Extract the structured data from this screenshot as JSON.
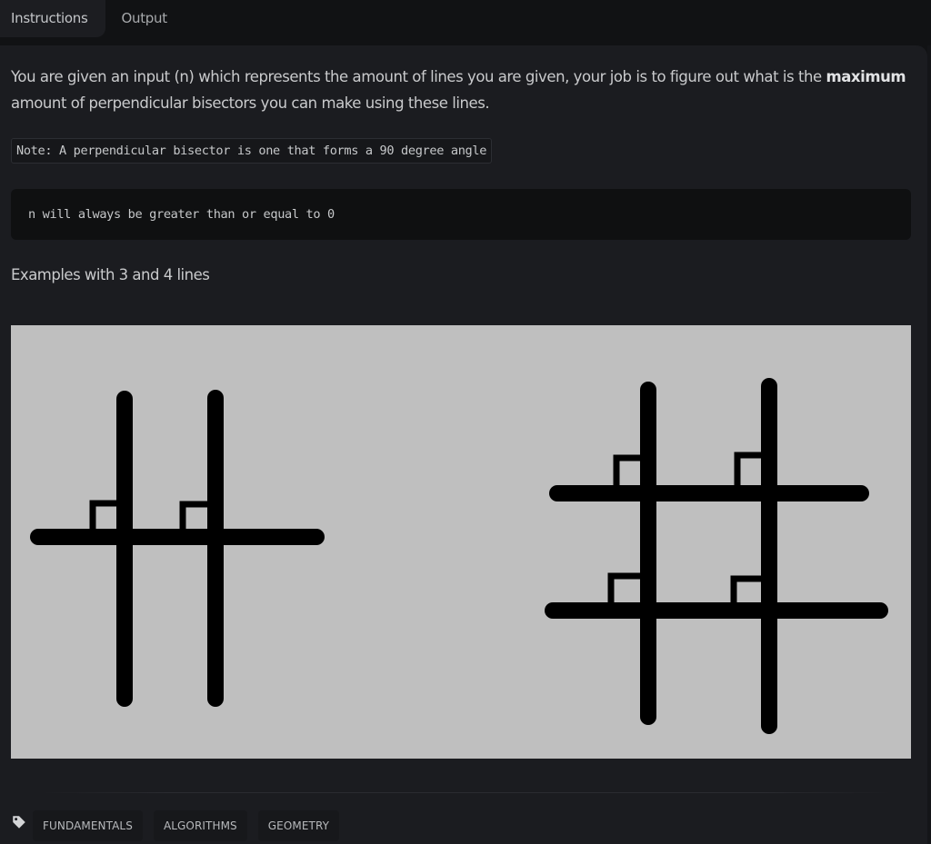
{
  "tabs": [
    {
      "label": "Instructions",
      "active": true
    },
    {
      "label": "Output",
      "active": false
    }
  ],
  "description": {
    "text_before_bold": "You are given an input (n) which represents the amount of lines you are given, your job is to figure out what is the ",
    "bold": "maximum",
    "text_after_bold": " amount of perpendicular bisectors you can make using these lines."
  },
  "note": "Note: A perpendicular bisector is one that forms a 90 degree angle",
  "code_block": "n will always be greater than or equal to 0",
  "examples_heading": "Examples with 3 and 4 lines",
  "figure": {
    "background": "#bfbfbf",
    "stroke": "#000000",
    "examples": [
      {
        "lines": 3,
        "vertical_lines": 2,
        "horizontal_lines": 1,
        "right_angle_marks": 2
      },
      {
        "lines": 4,
        "vertical_lines": 2,
        "horizontal_lines": 2,
        "right_angle_marks": 4
      }
    ]
  },
  "tags": {
    "icon": "tag-icon",
    "items": [
      "FUNDAMENTALS",
      "ALGORITHMS",
      "GEOMETRY"
    ]
  }
}
